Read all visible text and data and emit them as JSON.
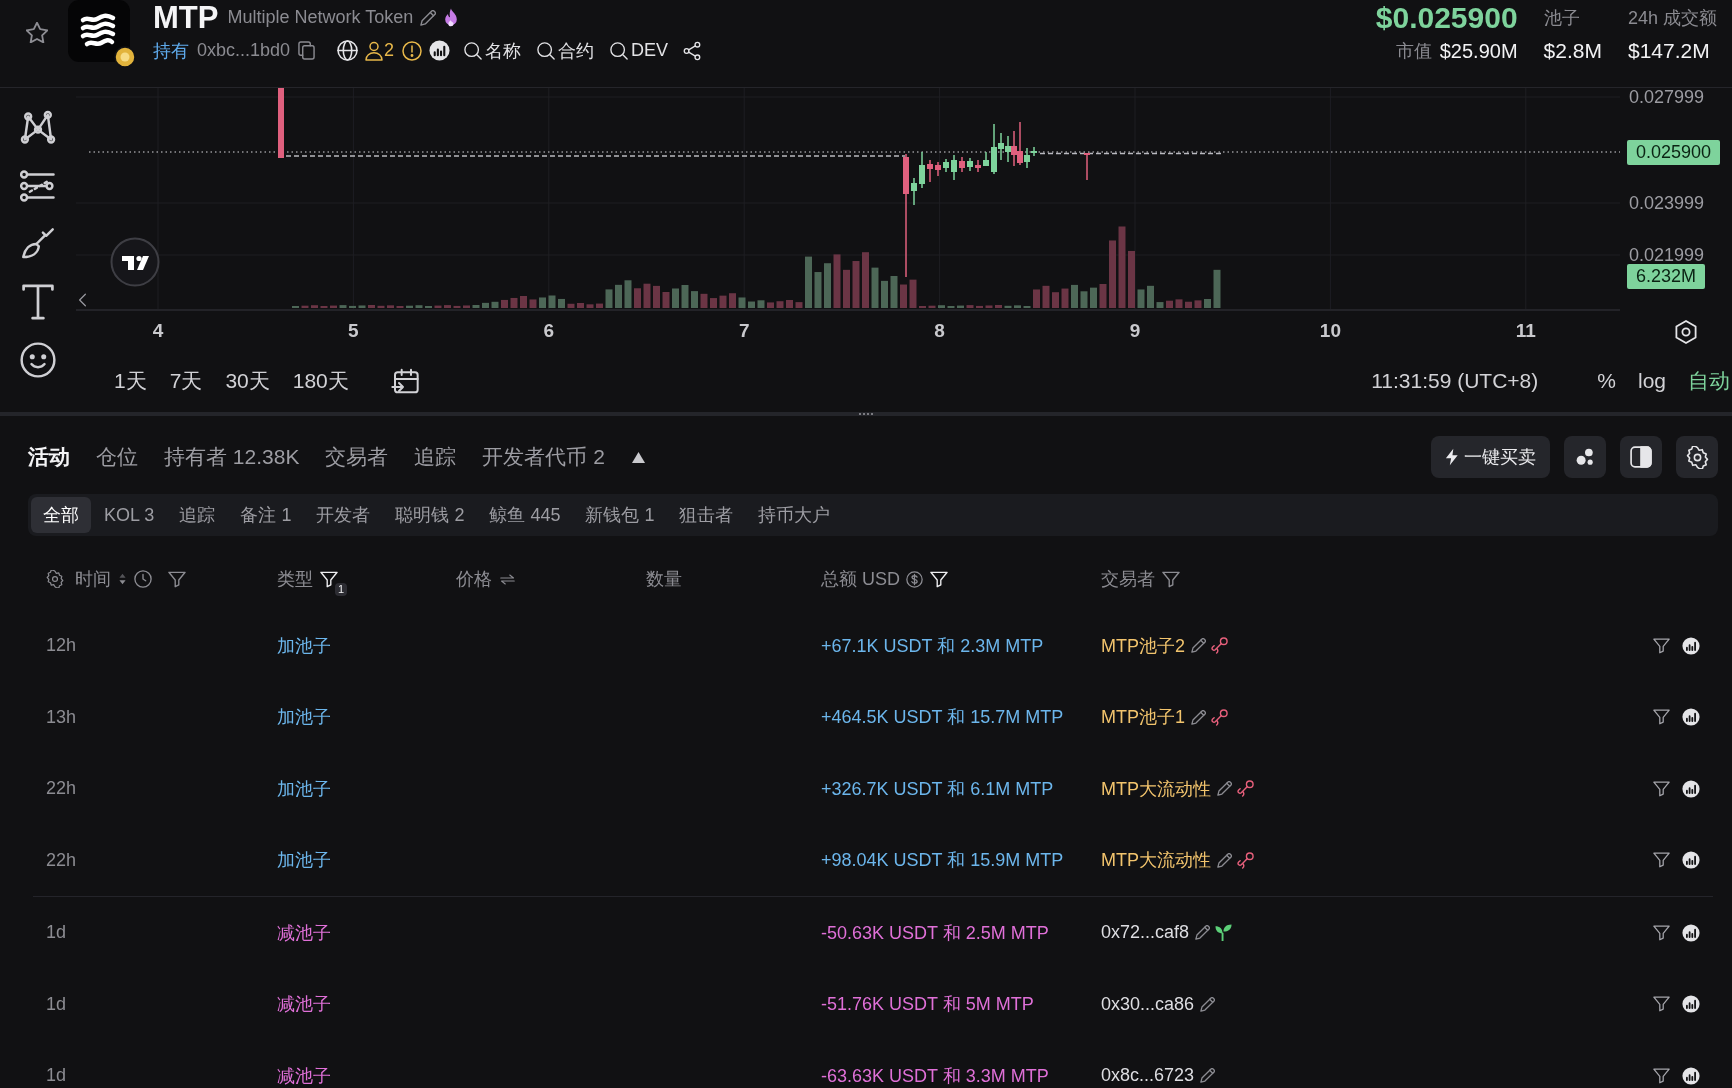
{
  "header": {
    "favorited": false,
    "symbol": "MTP",
    "name": "Multiple Network Token",
    "holder_label": "持有",
    "address": "0xbc...1bd0",
    "holder_count": "2",
    "search_links": [
      {
        "label": "名称"
      },
      {
        "label": "合约"
      },
      {
        "label": "DEV"
      }
    ],
    "price": "$0.025900",
    "market_cap_label": "市值",
    "market_cap": "$25.90M",
    "stats": [
      {
        "label": "池子",
        "value": "$2.8M"
      },
      {
        "label": "24h 成交额",
        "value": "$147.2M"
      }
    ]
  },
  "chart": {
    "price_labels": [
      "0.027999",
      "0.023999",
      "0.021999"
    ],
    "current_price": "0.025900",
    "volume_reading": "6.232M",
    "date_labels": [
      "4",
      "5",
      "6",
      "7",
      "8",
      "9",
      "10",
      "11"
    ],
    "ranges": [
      {
        "label": "1天"
      },
      {
        "label": "7天"
      },
      {
        "label": "30天"
      },
      {
        "label": "180天"
      }
    ],
    "clock": "11:31:59 (UTC+8)",
    "scale_options": [
      {
        "label": "%",
        "selected": false
      },
      {
        "label": "log",
        "selected": false
      },
      {
        "label": "自动",
        "selected": true
      }
    ]
  },
  "tabs": [
    {
      "label": "活动",
      "selected": true
    },
    {
      "label": "仓位",
      "selected": false
    },
    {
      "label": "持有者 12.38K",
      "selected": false
    },
    {
      "label": "交易者",
      "selected": false
    },
    {
      "label": "追踪",
      "selected": false
    },
    {
      "label": "开发者代币 2",
      "selected": false
    }
  ],
  "quick_trade_button": {
    "label": "一键买卖"
  },
  "filters": [
    {
      "label": "全部",
      "selected": true
    },
    {
      "label": "KOL 3",
      "selected": false
    },
    {
      "label": "追踪",
      "selected": false
    },
    {
      "label": "备注 1",
      "selected": false
    },
    {
      "label": "开发者",
      "selected": false
    },
    {
      "label": "聪明钱 2",
      "selected": false
    },
    {
      "label": "鲸鱼 445",
      "selected": false
    },
    {
      "label": "新钱包 1",
      "selected": false
    },
    {
      "label": "狙击者",
      "selected": false
    },
    {
      "label": "持币大户",
      "selected": false
    }
  ],
  "table": {
    "columns": [
      {
        "kind": "time",
        "label": "时间",
        "filtered": false
      },
      {
        "kind": "type",
        "label": "类型",
        "filtered": true,
        "filter_count": "1"
      },
      {
        "kind": "price",
        "label": "价格"
      },
      {
        "kind": "quantity",
        "label": "数量"
      },
      {
        "kind": "total",
        "label": "总额 USD",
        "filtered": true
      },
      {
        "kind": "trader",
        "label": "交易者",
        "filtered": false
      }
    ],
    "row_groups": [
      {
        "rows": [
          {
            "time": "12h",
            "kind": "add",
            "type": "加池子",
            "amount": "+67.1K USDT 和 2.3M MTP",
            "trader": {
              "kind": "pool",
              "name": "MTP池子2",
              "icons": [
                {
                  "kind": "key"
                }
              ]
            }
          },
          {
            "time": "13h",
            "kind": "add",
            "type": "加池子",
            "amount": "+464.5K USDT 和 15.7M MTP",
            "trader": {
              "kind": "pool",
              "name": "MTP池子1",
              "icons": [
                {
                  "kind": "key"
                }
              ]
            }
          },
          {
            "time": "22h",
            "kind": "add",
            "type": "加池子",
            "amount": "+326.7K USDT 和 6.1M MTP",
            "trader": {
              "kind": "pool",
              "name": "MTP大流动性",
              "icons": [
                {
                  "kind": "key"
                }
              ]
            }
          },
          {
            "time": "22h",
            "kind": "add",
            "type": "加池子",
            "amount": "+98.04K USDT 和 15.9M MTP",
            "trader": {
              "kind": "pool",
              "name": "MTP大流动性",
              "icons": [
                {
                  "kind": "key"
                }
              ]
            }
          }
        ]
      },
      {
        "rows": [
          {
            "time": "1d",
            "kind": "remove",
            "type": "减池子",
            "amount": "-50.63K USDT 和 2.5M MTP",
            "trader": {
              "kind": "wallet",
              "name": "0x72...caf8",
              "icons": [
                {
                  "kind": "sprout"
                }
              ]
            }
          },
          {
            "time": "1d",
            "kind": "remove",
            "type": "减池子",
            "amount": "-51.76K USDT 和 5M MTP",
            "trader": {
              "kind": "wallet",
              "name": "0x30...ca86"
            }
          },
          {
            "time": "1d",
            "kind": "remove",
            "type": "减池子",
            "amount": "-63.63K USDT 和 3.3M MTP",
            "trader": {
              "kind": "wallet",
              "name": "0x8c...6723"
            }
          }
        ]
      }
    ]
  }
}
